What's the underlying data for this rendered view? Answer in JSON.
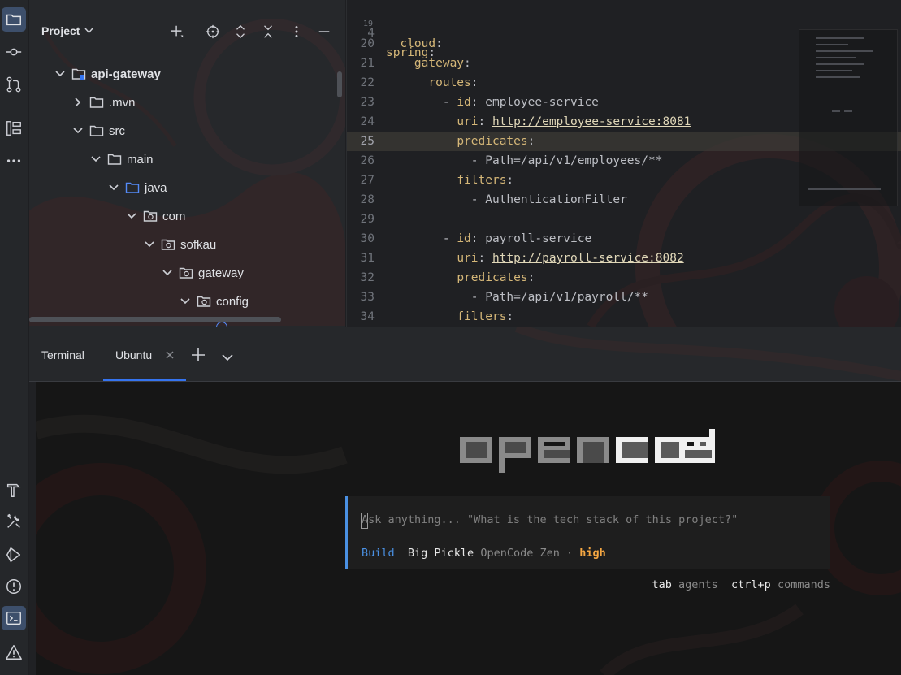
{
  "project": {
    "title": "Project",
    "tree": [
      {
        "label": "api-gateway",
        "expanded": true,
        "bold": true
      },
      {
        "label": ".mvn",
        "expanded": false
      },
      {
        "label": "src",
        "expanded": true
      },
      {
        "label": "main",
        "expanded": true
      },
      {
        "label": "java",
        "expanded": true
      },
      {
        "label": "com",
        "expanded": true
      },
      {
        "label": "sofkau",
        "expanded": true
      },
      {
        "label": "gateway",
        "expanded": true
      },
      {
        "label": "config",
        "expanded": true
      }
    ]
  },
  "editor": {
    "sticky": {
      "num": "4",
      "key": "spring"
    },
    "current_line": "25",
    "lines": [
      {
        "num": "20",
        "parts": [
          {
            "t": "  ",
            "c": "v"
          },
          {
            "t": "cloud",
            "c": "k"
          },
          {
            "t": ":",
            "c": "v"
          }
        ]
      },
      {
        "num": "21",
        "parts": [
          {
            "t": "    ",
            "c": "v"
          },
          {
            "t": "gateway",
            "c": "k"
          },
          {
            "t": ":",
            "c": "v"
          }
        ]
      },
      {
        "num": "22",
        "parts": [
          {
            "t": "      ",
            "c": "v"
          },
          {
            "t": "routes",
            "c": "k"
          },
          {
            "t": ":",
            "c": "v"
          }
        ]
      },
      {
        "num": "23",
        "parts": [
          {
            "t": "        - ",
            "c": "v"
          },
          {
            "t": "id",
            "c": "k"
          },
          {
            "t": ": employee-service",
            "c": "v"
          }
        ]
      },
      {
        "num": "24",
        "parts": [
          {
            "t": "          ",
            "c": "v"
          },
          {
            "t": "uri",
            "c": "k"
          },
          {
            "t": ": ",
            "c": "v"
          },
          {
            "t": "http://employee-service:8081",
            "c": "u"
          }
        ]
      },
      {
        "num": "25",
        "parts": [
          {
            "t": "          ",
            "c": "v"
          },
          {
            "t": "predicates",
            "c": "k"
          },
          {
            "t": ":",
            "c": "v"
          }
        ]
      },
      {
        "num": "26",
        "parts": [
          {
            "t": "            - Path=/api/v1/employees/**",
            "c": "v"
          }
        ]
      },
      {
        "num": "27",
        "parts": [
          {
            "t": "          ",
            "c": "v"
          },
          {
            "t": "filters",
            "c": "k"
          },
          {
            "t": ":",
            "c": "v"
          }
        ]
      },
      {
        "num": "28",
        "parts": [
          {
            "t": "            - AuthenticationFilter",
            "c": "v"
          }
        ]
      },
      {
        "num": "29",
        "parts": []
      },
      {
        "num": "30",
        "parts": [
          {
            "t": "        - ",
            "c": "v"
          },
          {
            "t": "id",
            "c": "k"
          },
          {
            "t": ": payroll-service",
            "c": "v"
          }
        ]
      },
      {
        "num": "31",
        "parts": [
          {
            "t": "          ",
            "c": "v"
          },
          {
            "t": "uri",
            "c": "k"
          },
          {
            "t": ": ",
            "c": "v"
          },
          {
            "t": "http://payroll-service:8082",
            "c": "u"
          }
        ]
      },
      {
        "num": "32",
        "parts": [
          {
            "t": "          ",
            "c": "v"
          },
          {
            "t": "predicates",
            "c": "k"
          },
          {
            "t": ":",
            "c": "v"
          }
        ]
      },
      {
        "num": "33",
        "parts": [
          {
            "t": "            - Path=/api/v1/payroll/**",
            "c": "v"
          }
        ]
      },
      {
        "num": "34",
        "parts": [
          {
            "t": "          ",
            "c": "v"
          },
          {
            "t": "filters",
            "c": "k"
          },
          {
            "t": ":",
            "c": "v"
          }
        ]
      }
    ]
  },
  "terminal_bar": {
    "title": "Terminal",
    "tab": "Ubuntu"
  },
  "opencode": {
    "prompt_placeholder": "Ask anything... \"What is the tech stack of this project?\"",
    "mode": "Build",
    "model": "Big Pickle",
    "provider": "OpenCode Zen",
    "separator": "·",
    "effort": "high",
    "shortcuts": [
      {
        "key": "tab",
        "desc": "agents"
      },
      {
        "key": "ctrl+p",
        "desc": "commands"
      }
    ]
  },
  "colors": {
    "accent": "#3574f0",
    "mode": "#4a90e2",
    "effort": "#f5a742",
    "yaml_key": "#d5b778"
  },
  "icons": [
    "folder-icon",
    "commit-icon",
    "pull-request-icon",
    "structure-icon",
    "more-icon",
    "hammer-icon",
    "tools-icon",
    "run-icon",
    "problems-icon",
    "terminal-icon",
    "warning-icon"
  ]
}
